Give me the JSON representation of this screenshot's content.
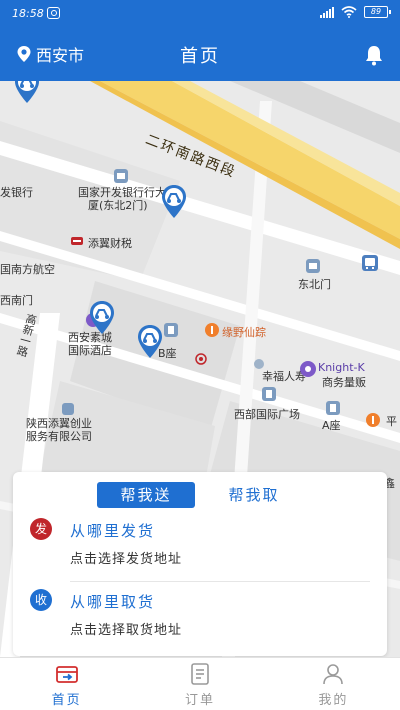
{
  "status_bar": {
    "time": "18:58",
    "battery": "89"
  },
  "header": {
    "city": "西安市",
    "title": "首页"
  },
  "map": {
    "road_name": "二环南路西段",
    "pois": [
      "发银行",
      "国家开发银行行大",
      "厦(东北2门)",
      "添翼财税",
      "国南方航空",
      "东北门",
      "西南门",
      "高新一路",
      "西安素城",
      "国际酒店",
      "B座",
      "缘野仙踪",
      "幸福人寿",
      "Knight-K",
      "商务量贩",
      "西部国际广场",
      "A座",
      "平",
      "陕西添翼创业",
      "服务有限公司",
      "鑫"
    ]
  },
  "order_card": {
    "tabs": [
      "帮我送",
      "帮我取"
    ],
    "active_tab": "帮我送",
    "send": {
      "badge": "发",
      "title": "从哪里发货",
      "hint": "点击选择发货地址"
    },
    "receive": {
      "badge": "收",
      "title": "从哪里取货",
      "hint": "点击选择取货地址"
    }
  },
  "tabbar": {
    "items": [
      {
        "label": "首页",
        "icon": "home-icon",
        "active": true
      },
      {
        "label": "订单",
        "icon": "orders-icon",
        "active": false
      },
      {
        "label": "我的",
        "icon": "profile-icon",
        "active": false
      }
    ]
  },
  "colors": {
    "primary": "#1f6fd1",
    "send_badge": "#c0262b",
    "receive_badge": "#1f6fd1",
    "road": "#f6d56b",
    "poi_orange": "#f07f2c",
    "poi_purple": "#7d5ac8"
  }
}
